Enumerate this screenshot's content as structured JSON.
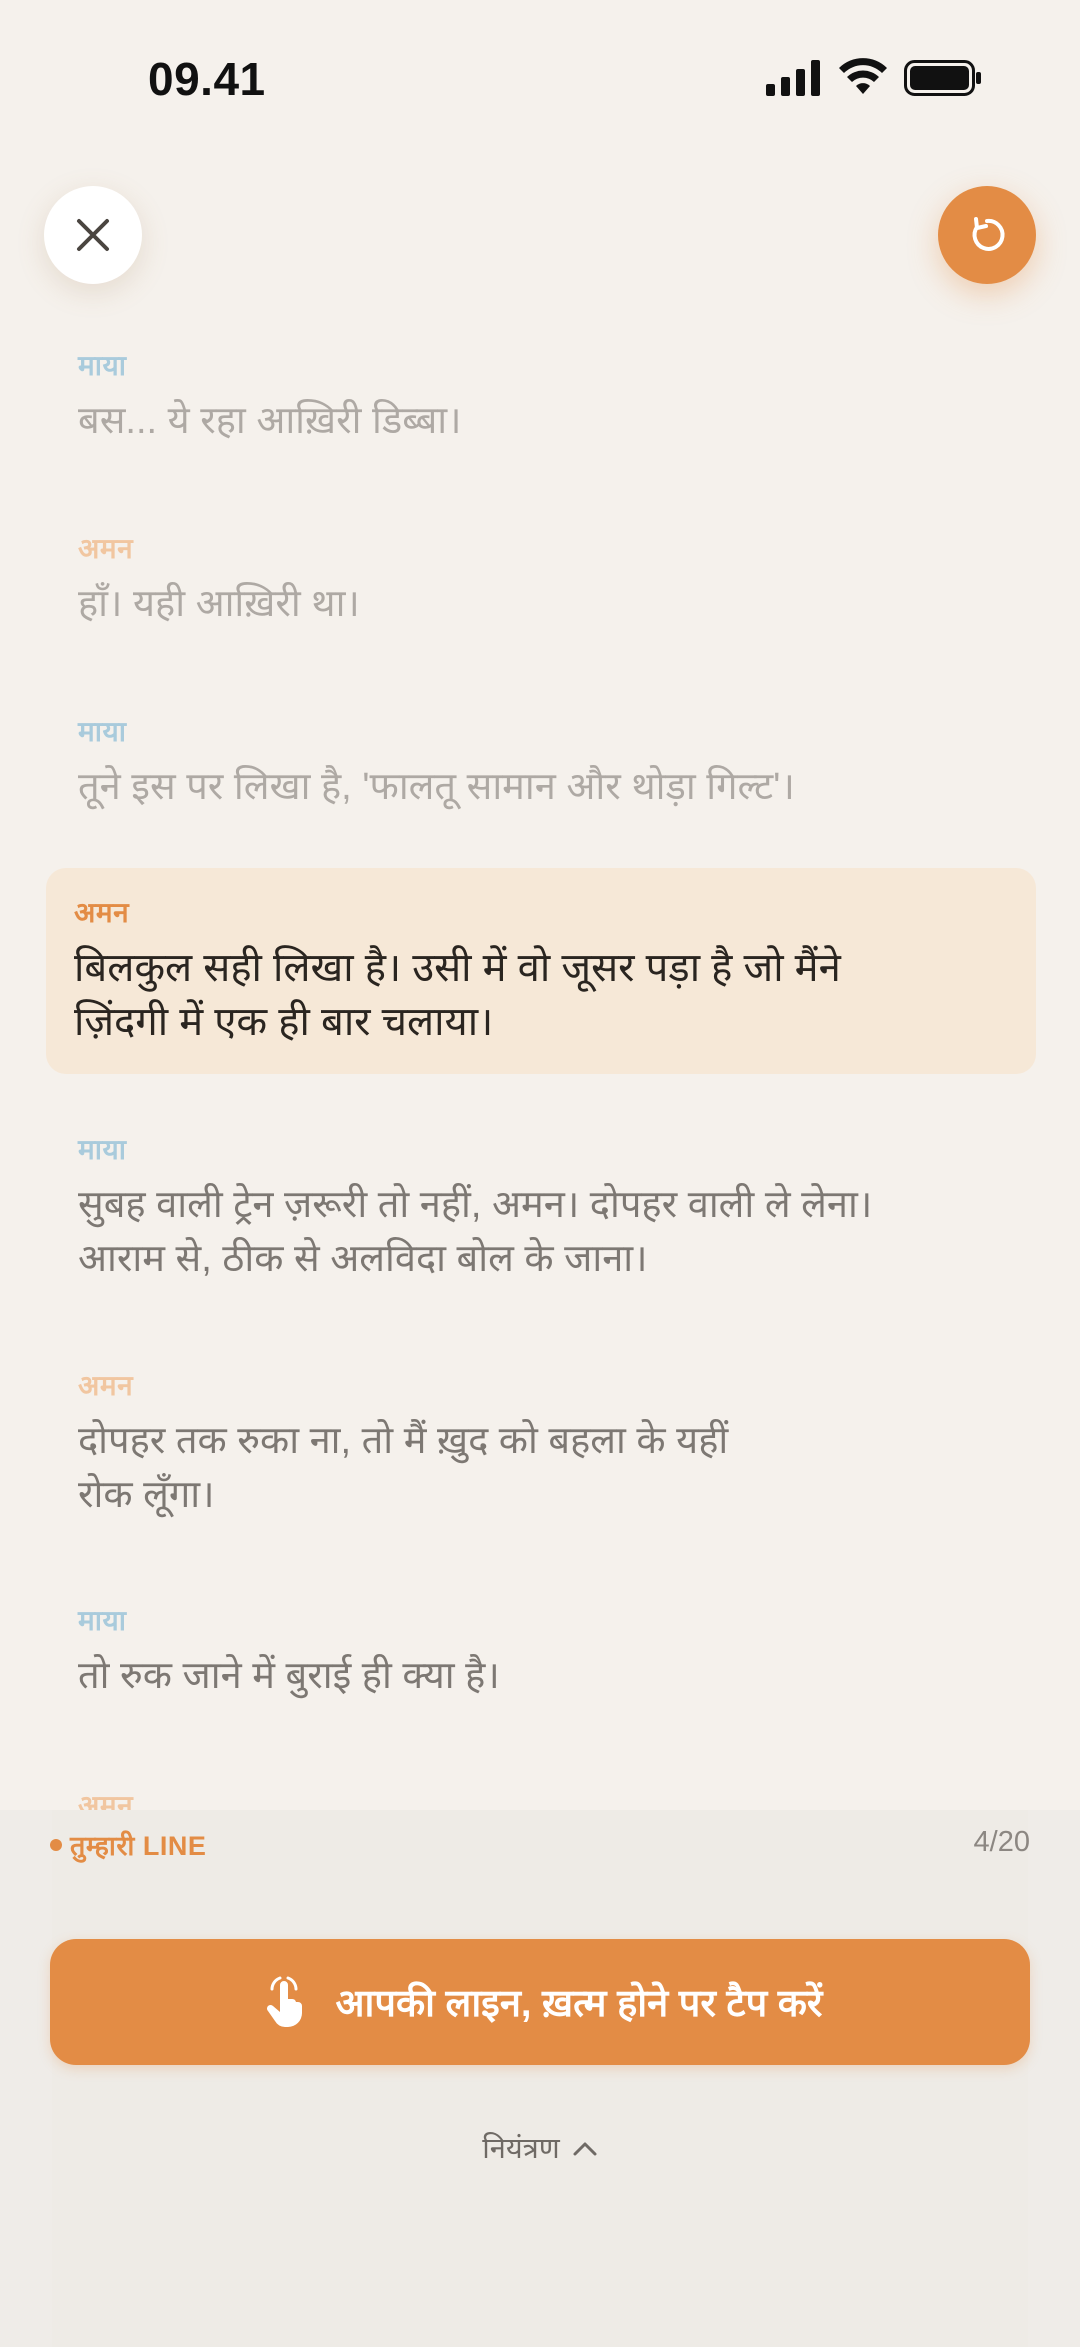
{
  "status_bar": {
    "time": "09.41"
  },
  "script": {
    "lines": [
      {
        "speaker": "माया",
        "text": "बस... ये रहा आख़िरी डिब्बा।"
      },
      {
        "speaker": "अमन",
        "text": "हाँ। यही आख़िरी था।"
      },
      {
        "speaker": "माया",
        "text": "तूने इस पर लिखा है, 'फालतू सामान और थोड़ा गिल्ट'।"
      },
      {
        "speaker": "अमन",
        "text_1": "बिलकुल सही लिखा है। उसी में वो जूसर पड़ा है जो मैंने",
        "text_2": "ज़िंदगी में एक ही बार चलाया।"
      },
      {
        "speaker": "माया",
        "text_1": "सुबह वाली ट्रेन ज़रूरी तो नहीं, अमन। दोपहर वाली ले लेना।",
        "text_2": "आराम से, ठीक से अलविदा बोल के जाना।"
      },
      {
        "speaker": "अमन",
        "text_1": "दोपहर तक रुका ना, तो मैं ख़ुद को बहला के यहीं",
        "text_2": "रोक लूँगा।"
      },
      {
        "speaker": "माया",
        "text": "तो रुक जाने में बुराई ही क्या है।"
      },
      {
        "speaker": "अमन"
      }
    ]
  },
  "panel": {
    "your_line_label": "तुम्हारी LINE",
    "progress": "4/20",
    "tap_button_label": "आपकी लाइन, ख़त्म होने पर टैप करें",
    "controls_label": "नियंत्रण"
  },
  "icons": {
    "close": "close-icon",
    "restart": "restart-icon",
    "tap": "tap-hand-icon",
    "chevron": "chevron-up-icon"
  },
  "colors": {
    "accent": "#e38c45",
    "maya": "#a9cbdc",
    "aman": "#f1c6a0",
    "highlight": "#f6e8d7"
  }
}
